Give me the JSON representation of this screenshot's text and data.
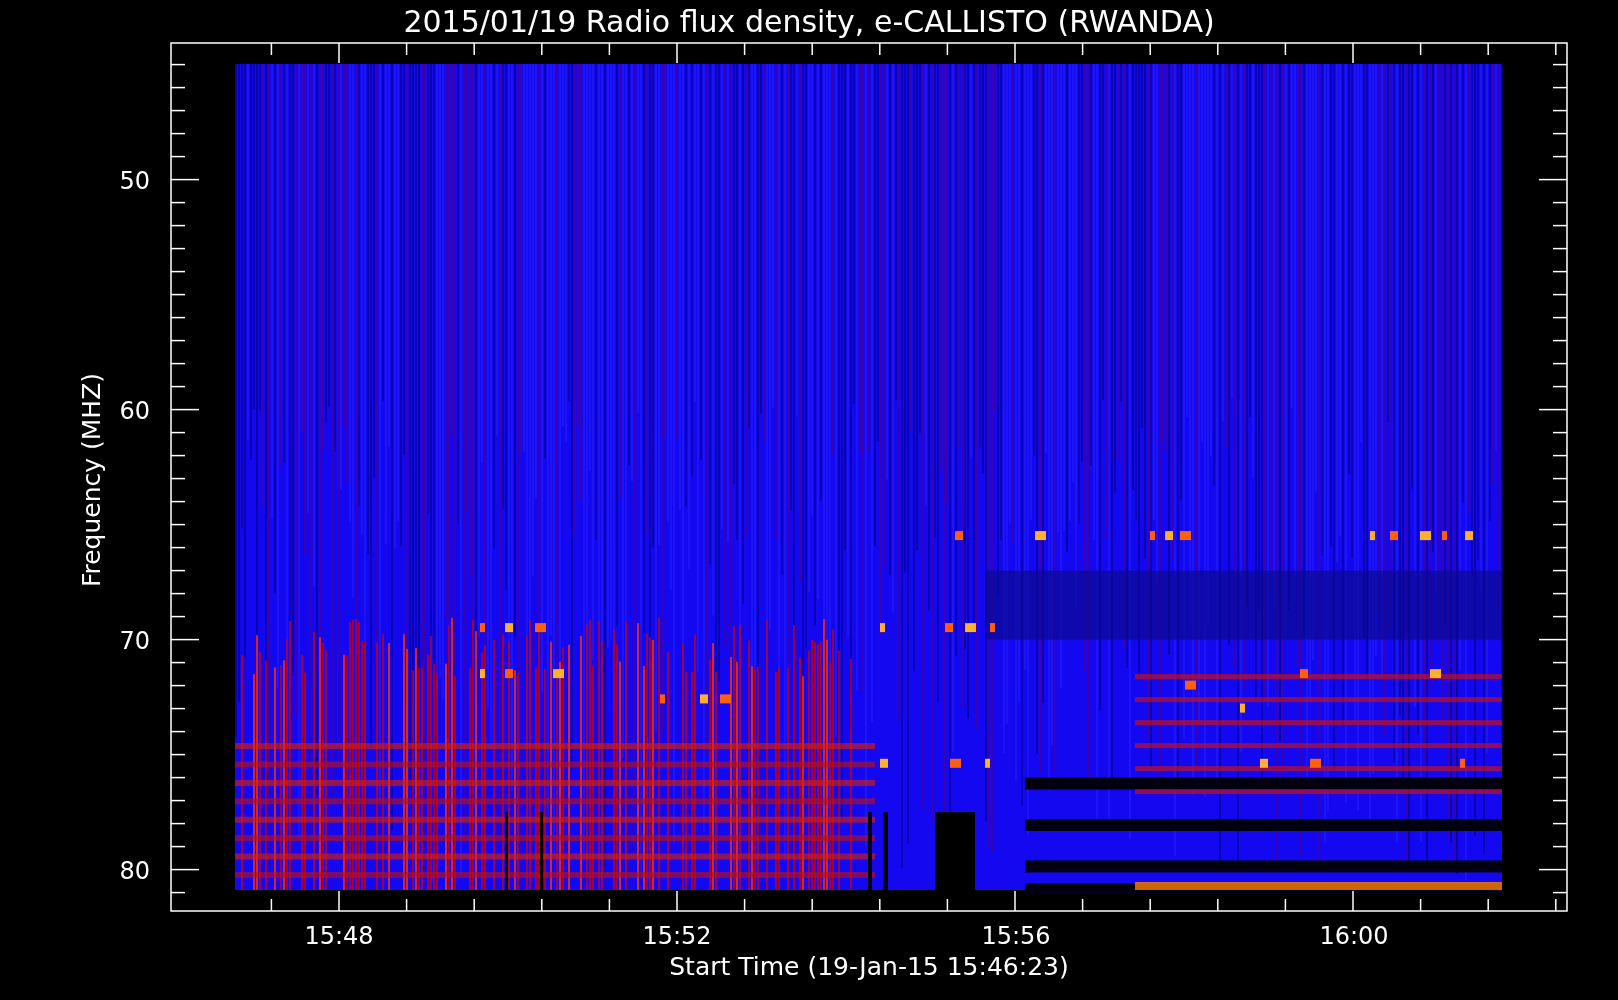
{
  "title": "2015/01/19  Radio flux density, e-CALLISTO (RWANDA)",
  "y_axis": {
    "label": "Frequency (MHZ)",
    "ticks": [
      "50",
      "60",
      "70",
      "80"
    ]
  },
  "x_axis": {
    "label": "Start Time (19-Jan-15 15:46:23)",
    "ticks": [
      "15:48",
      "15:52",
      "15:56",
      "16:00"
    ]
  }
}
